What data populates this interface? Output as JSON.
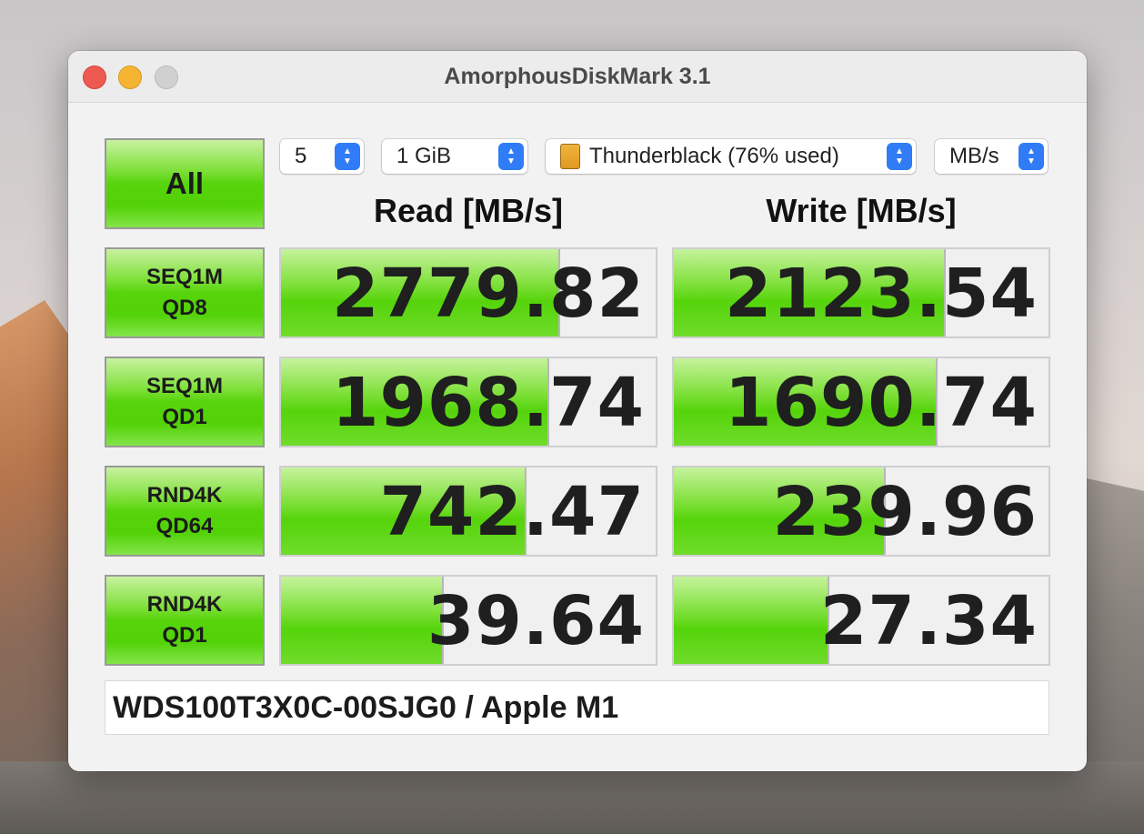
{
  "window": {
    "title": "AmorphousDiskMark 3.1"
  },
  "controls": {
    "all_label": "All",
    "count": "5",
    "size": "1 GiB",
    "drive": "Thunderblack (76% used)",
    "unit": "MB/s"
  },
  "headers": {
    "read": "Read [MB/s]",
    "write": "Write [MB/s]"
  },
  "tests": [
    {
      "line1": "SEQ1M",
      "line2": "QD8",
      "read": "2779.82",
      "write": "2123.54",
      "read_fill_pct": 74,
      "write_fill_pct": 72
    },
    {
      "line1": "SEQ1M",
      "line2": "QD1",
      "read": "1968.74",
      "write": "1690.74",
      "read_fill_pct": 71,
      "write_fill_pct": 70
    },
    {
      "line1": "RND4K",
      "line2": "QD64",
      "read": "742.47",
      "write": "239.96",
      "read_fill_pct": 65,
      "write_fill_pct": 56
    },
    {
      "line1": "RND4K",
      "line2": "QD1",
      "read": "39.64",
      "write": "27.34",
      "read_fill_pct": 43,
      "write_fill_pct": 41
    }
  ],
  "footer": {
    "device": "WDS100T3X0C-00SJG0 / Apple M1"
  },
  "colors": {
    "accent_green": "#56d40c",
    "stepper_blue": "#2f7cf6",
    "close_red": "#ed5a52",
    "minimize_yellow": "#f5b431"
  }
}
